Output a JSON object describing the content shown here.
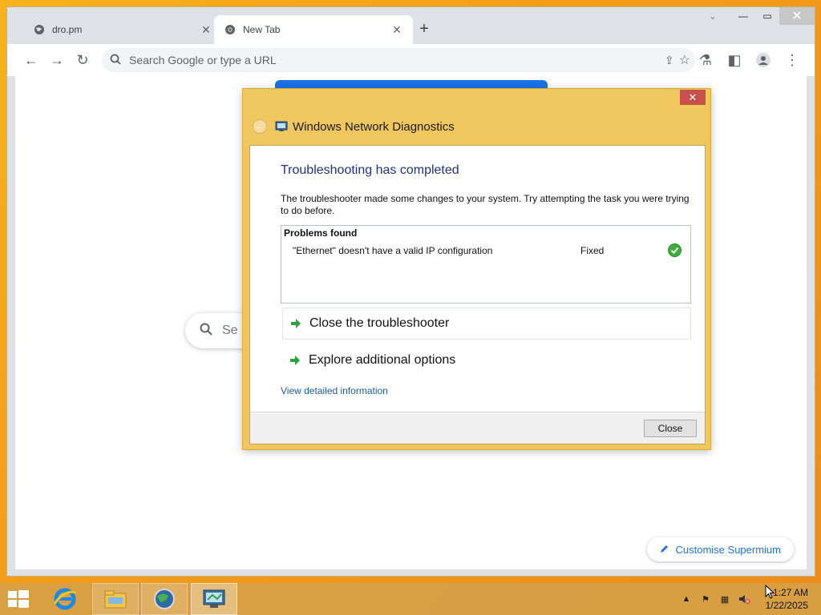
{
  "browser": {
    "tabs": [
      {
        "title": "dro.pm",
        "active": false
      },
      {
        "title": "New Tab",
        "active": true
      }
    ],
    "omnibox_placeholder": "Search Google or type a URL",
    "google_search_partial": "Se",
    "customise_label": "Customise Supermium"
  },
  "dialog": {
    "window_title": "Windows Network Diagnostics",
    "heading": "Troubleshooting has completed",
    "description": "The troubleshooter made some changes to your system. Try attempting the task you were trying to do before.",
    "problems_header": "Problems found",
    "problems": [
      {
        "text": "\"Ethernet\" doesn't have a valid IP configuration",
        "status": "Fixed"
      }
    ],
    "option_close": "Close the troubleshooter",
    "option_explore": "Explore additional options",
    "detail_link": "View detailed information",
    "close_button": "Close"
  },
  "taskbar": {
    "time": "1:27 AM",
    "date": "1/22/2025"
  },
  "colors": {
    "accent_blue": "#1a73e8",
    "dialog_frame": "#f0c75e",
    "heading_blue": "#1e3287",
    "close_red": "#c7504a"
  }
}
